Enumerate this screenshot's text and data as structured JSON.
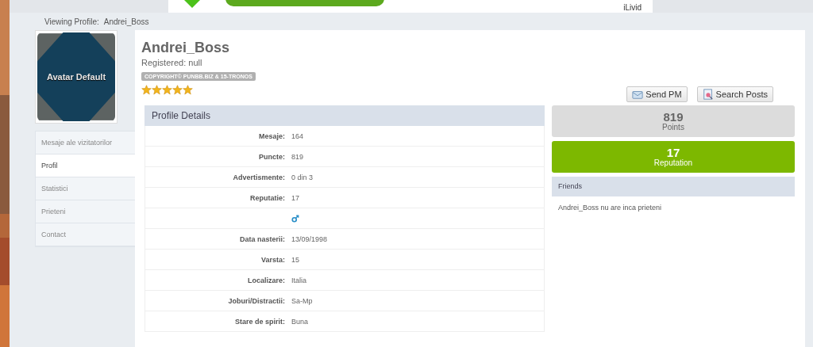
{
  "banner": {
    "brand": "iLivid"
  },
  "breadcrumb": {
    "label": "Viewing Profile:",
    "value": "Andrei_Boss"
  },
  "avatar": {
    "label": "Avatar Default"
  },
  "sidebar": {
    "items": [
      {
        "label": "Mesaje ale vizitatorilor",
        "selected": false
      },
      {
        "label": "Profil",
        "selected": true
      },
      {
        "label": "Statistici",
        "selected": false
      },
      {
        "label": "Prieteni",
        "selected": false
      },
      {
        "label": "Contact",
        "selected": false
      }
    ]
  },
  "profile": {
    "name": "Andrei_Boss",
    "registered": "Registered: null",
    "badge": "COPYRIGHT© PUNBB.BIZ & 15-TRONOS",
    "stars": 5
  },
  "buttons": [
    {
      "label": "Send PM",
      "kind": "mail"
    },
    {
      "label": "Search Posts",
      "kind": "search"
    }
  ],
  "details": {
    "title": "Profile Details",
    "rows": [
      {
        "kind": "text",
        "label": "Mesaje:",
        "value": "164"
      },
      {
        "kind": "text",
        "label": "Puncte:",
        "value": "819"
      },
      {
        "kind": "text",
        "label": "Advertismente:",
        "value": "0 din 3"
      },
      {
        "kind": "text",
        "label": "Reputatie:",
        "value": "17"
      },
      {
        "kind": "gender"
      },
      {
        "kind": "text",
        "label": "Data nasterii:",
        "value": "13/09/1998"
      },
      {
        "kind": "text",
        "label": "Varsta:",
        "value": "15"
      },
      {
        "kind": "text",
        "label": "Localizare:",
        "value": "Italia"
      },
      {
        "kind": "text",
        "label": "Joburi/Distractii:",
        "value": "Sa-Mp"
      },
      {
        "kind": "text",
        "label": "Stare de spirit:",
        "value": "Buna"
      }
    ]
  },
  "stats": [
    {
      "value": "819",
      "label": "Points",
      "kind": "points"
    },
    {
      "value": "17",
      "label": "Reputation",
      "kind": "reputation"
    }
  ],
  "friends": {
    "title": "Friends",
    "text": "Andrei_Boss nu are inca prieteni"
  }
}
